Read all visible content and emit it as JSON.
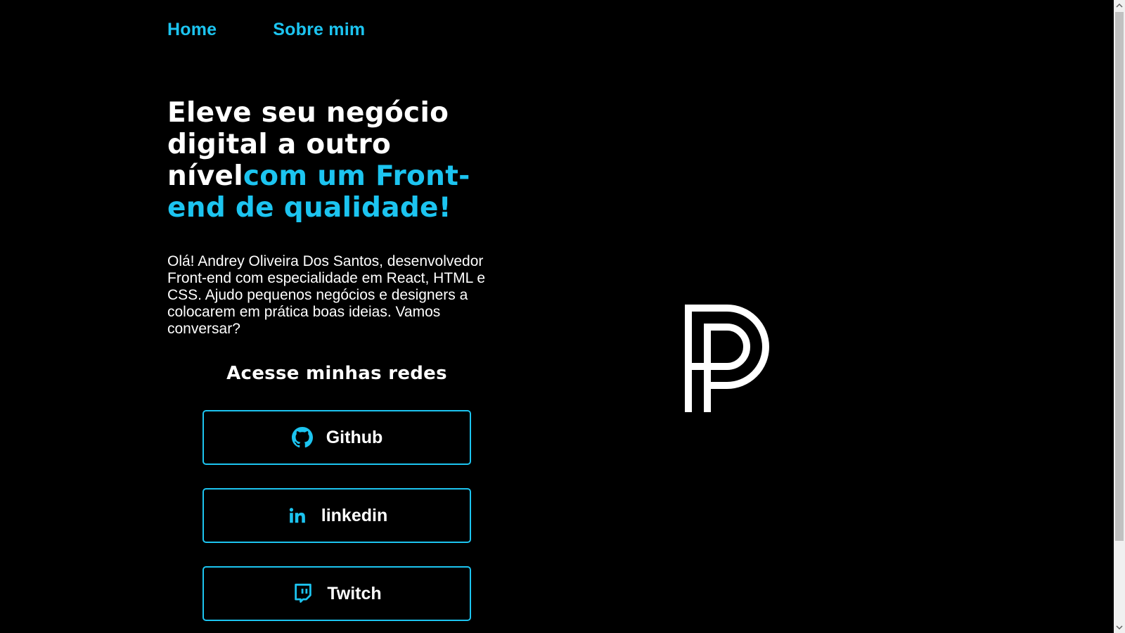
{
  "nav": {
    "items": [
      {
        "label": "Home"
      },
      {
        "label": "Sobre mim"
      }
    ]
  },
  "hero": {
    "headline_white": "Eleve seu negócio digital a outro nível",
    "headline_accent": "com um Front-end de qualidade!",
    "intro": "Olá! Andrey Oliveira Dos Santos, desenvolvedor Front-end com especialidade em React, HTML e CSS. Ajudo pequenos negócios e designers a colocarem em prática boas ideias. Vamos conversar?"
  },
  "social": {
    "title": "Acesse minhas redes",
    "links": [
      {
        "label": "Github",
        "icon": "github-icon"
      },
      {
        "label": "linkedin",
        "icon": "linkedin-icon"
      },
      {
        "label": "Twitch",
        "icon": "twitch-icon"
      }
    ]
  },
  "colors": {
    "accent": "#1cc4f0",
    "background": "#000000",
    "text": "#ffffff"
  }
}
